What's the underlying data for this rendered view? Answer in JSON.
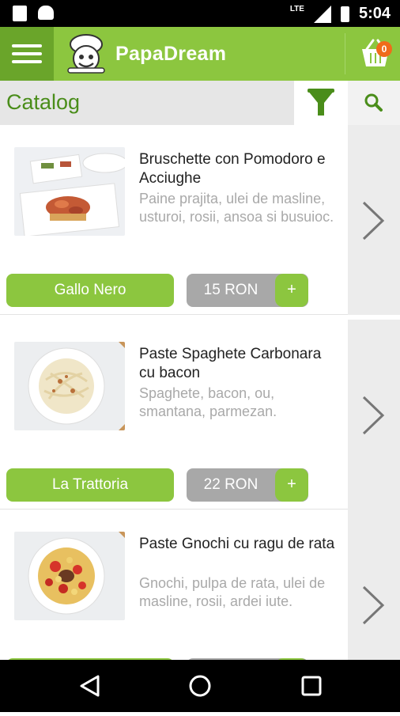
{
  "status_bar": {
    "network": "LTE",
    "time": "5:04"
  },
  "app_bar": {
    "title": "PapaDream",
    "cart_count": "0"
  },
  "sub_header": {
    "title": "Catalog"
  },
  "products": [
    {
      "name": "Bruschette con Pomodoro e Acciughe",
      "description": "Paine prajita, ulei de masline, usturoi, rosii, ansoa si busuioc.",
      "restaurant": "Gallo Nero",
      "price": "15 RON",
      "add_label": "+"
    },
    {
      "name": "Paste Spaghete Carbonara cu bacon",
      "description": "Spaghete, bacon, ou, smantana, parmezan.",
      "restaurant": "La Trattoria",
      "price": "22 RON",
      "add_label": "+"
    },
    {
      "name": "Paste Gnochi cu ragu de rata",
      "description": "Gnochi, pulpa de rata, ulei de masline, rosii, ardei iute.",
      "restaurant": "",
      "price": "",
      "add_label": "+"
    }
  ],
  "colors": {
    "accent": "#8cc63f",
    "accent_dark": "#6aa52a",
    "title_green": "#4a8d1a",
    "badge": "#ef6c1a",
    "price_gray": "#a8a8a8"
  }
}
